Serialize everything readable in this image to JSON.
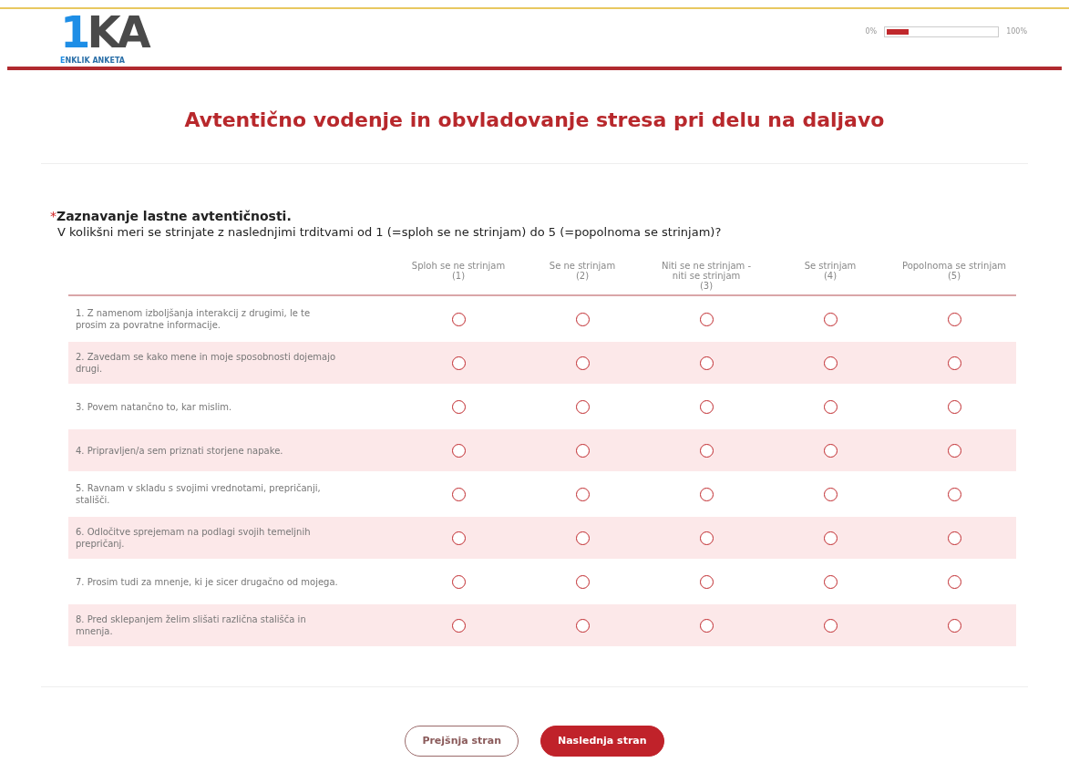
{
  "logo": {
    "digit": "1",
    "letters": "KA",
    "tagline_first": "E",
    "tagline_rest": "NKLIK ANKETA"
  },
  "progress": {
    "start_label": "0%",
    "end_label": "100%",
    "level": 0.2
  },
  "title": "Avtentično vodenje in obvladovanje stresa pri delu na daljavo",
  "question": {
    "required_mark": "*",
    "title": "Zaznavanje lastne avtentičnosti.",
    "subtitle": "V kolikšni meri se strinjate z naslednjimi trditvami od 1 (=sploh se ne strinjam) do 5 (=popolnoma se strinjam)?",
    "columns": [
      {
        "label": "Sploh se ne strinjam",
        "value": "(1)"
      },
      {
        "label": "Se ne strinjam",
        "value": "(2)"
      },
      {
        "label": "Niti se ne strinjam - niti se strinjam",
        "value": "(3)"
      },
      {
        "label": "Se strinjam",
        "value": "(4)"
      },
      {
        "label": "Popolnoma se strinjam",
        "value": "(5)"
      }
    ],
    "rows": [
      {
        "text": "1. Z namenom izboljšanja interakcij z drugimi, le te prosim za povratne informacije.",
        "options": [
          {
            "selected": false
          },
          {
            "selected": false
          },
          {
            "selected": false
          },
          {
            "selected": false
          },
          {
            "selected": false
          }
        ]
      },
      {
        "text": "2. Zavedam se kako mene in moje sposobnosti dojemajo drugi.",
        "options": [
          {
            "selected": false
          },
          {
            "selected": false
          },
          {
            "selected": false
          },
          {
            "selected": false
          },
          {
            "selected": false
          }
        ]
      },
      {
        "text": "3. Povem natančno to, kar mislim.",
        "options": [
          {
            "selected": false
          },
          {
            "selected": false
          },
          {
            "selected": false
          },
          {
            "selected": false
          },
          {
            "selected": false
          }
        ]
      },
      {
        "text": "4. Pripravljen/a sem priznati storjene napake.",
        "options": [
          {
            "selected": false
          },
          {
            "selected": false
          },
          {
            "selected": false
          },
          {
            "selected": false
          },
          {
            "selected": false
          }
        ]
      },
      {
        "text": "5. Ravnam v skladu s svojimi vrednotami, prepričanji, stališči.",
        "options": [
          {
            "selected": false
          },
          {
            "selected": false
          },
          {
            "selected": false
          },
          {
            "selected": false
          },
          {
            "selected": false
          }
        ]
      },
      {
        "text": "6. Odločitve sprejemam na podlagi svojih temeljnih prepričanj.",
        "options": [
          {
            "selected": false
          },
          {
            "selected": false
          },
          {
            "selected": false
          },
          {
            "selected": false
          },
          {
            "selected": false
          }
        ]
      },
      {
        "text": "7. Prosim tudi za mnenje, ki je sicer drugačno od mojega.",
        "options": [
          {
            "selected": false
          },
          {
            "selected": false
          },
          {
            "selected": false
          },
          {
            "selected": false
          },
          {
            "selected": false
          }
        ]
      },
      {
        "text": "8. Pred sklepanjem želim slišati različna stališča in mnenja.",
        "options": [
          {
            "selected": false
          },
          {
            "selected": false
          },
          {
            "selected": false
          },
          {
            "selected": false
          },
          {
            "selected": false
          }
        ]
      }
    ]
  },
  "buttons": [
    {
      "label": "Prejšnja stran",
      "kind": "secondary"
    },
    {
      "label": "Naslednja stran",
      "kind": "primary"
    }
  ]
}
